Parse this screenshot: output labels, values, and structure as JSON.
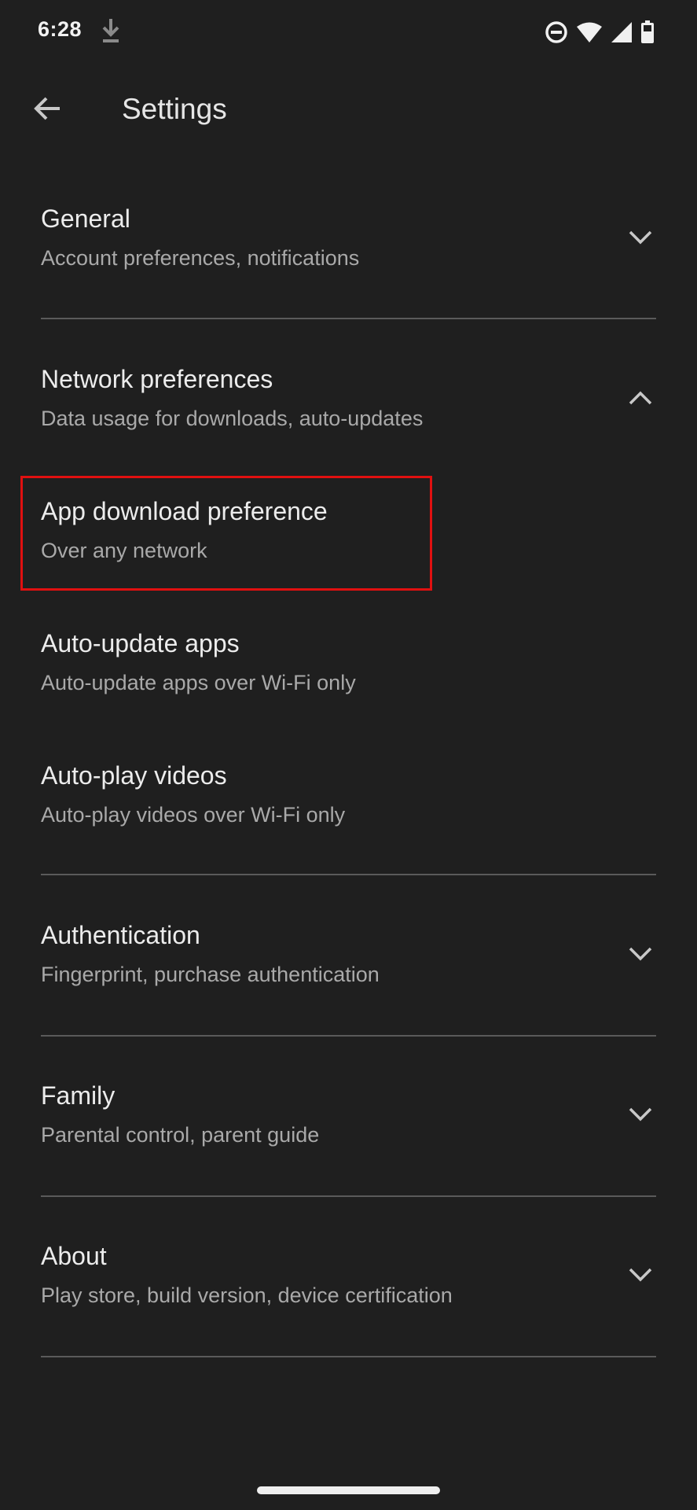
{
  "status_bar": {
    "time": "6:28",
    "icons": [
      "download-icon",
      "do-not-disturb-icon",
      "wifi-icon",
      "signal-icon",
      "battery-icon"
    ]
  },
  "app_bar": {
    "title": "Settings",
    "back_icon": "arrow-back-icon"
  },
  "sections": {
    "general": {
      "title": "General",
      "subtitle": "Account preferences, notifications",
      "expanded": false
    },
    "network": {
      "title": "Network preferences",
      "subtitle": "Data usage for downloads, auto-updates",
      "expanded": true,
      "items": [
        {
          "title": "App download preference",
          "subtitle": "Over any network"
        },
        {
          "title": "Auto-update apps",
          "subtitle": "Auto-update apps over Wi-Fi only"
        },
        {
          "title": "Auto-play videos",
          "subtitle": "Auto-play videos over Wi-Fi only"
        }
      ]
    },
    "authentication": {
      "title": "Authentication",
      "subtitle": "Fingerprint, purchase authentication",
      "expanded": false
    },
    "family": {
      "title": "Family",
      "subtitle": "Parental control, parent guide",
      "expanded": false
    },
    "about": {
      "title": "About",
      "subtitle": "Play store, build version, device certification",
      "expanded": false
    }
  },
  "colors": {
    "background": "#1f1f1f",
    "highlight": "#e01010",
    "divider": "#5a5a5a"
  }
}
